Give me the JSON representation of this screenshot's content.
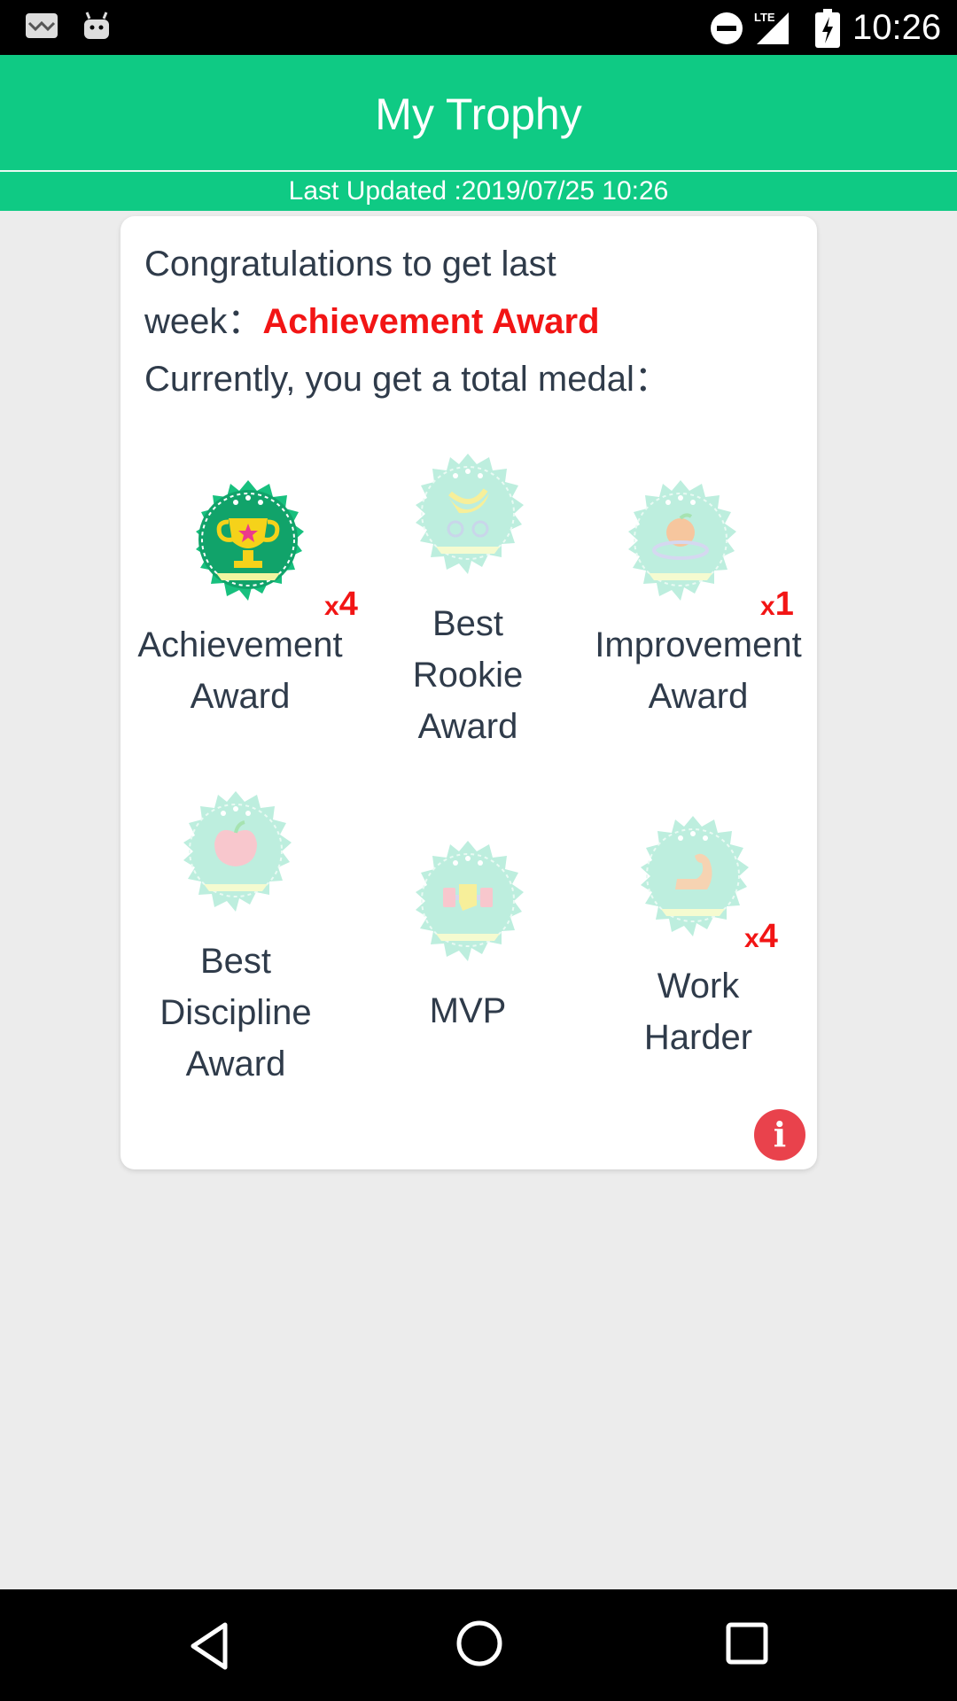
{
  "status_bar": {
    "time": "10:26",
    "network": "LTE",
    "icons": [
      "mail-icon",
      "android-icon",
      "do-not-disturb-icon",
      "lte-signal-icon",
      "battery-charging-icon"
    ]
  },
  "header": {
    "title": "My Trophy",
    "last_updated": "Last Updated :2019/07/25 10:26"
  },
  "card": {
    "congrats_line1": "Congratulations to get last",
    "congrats_line2_prefix": "week：",
    "award_name": "Achievement Award",
    "congrats_line3": "Currently, you get a total medal：",
    "medals": [
      {
        "label_lines": [
          "Achievement",
          "Award"
        ],
        "count_prefix": "x",
        "count": "4",
        "earned": true,
        "icon": "trophy-icon"
      },
      {
        "label_lines": [
          "Best",
          "Rookie",
          "Award"
        ],
        "count_prefix": "",
        "count": "",
        "earned": false,
        "icon": "banana-bike-icon"
      },
      {
        "label_lines": [
          "Improvement",
          "Award"
        ],
        "count_prefix": "x",
        "count": "1",
        "earned": false,
        "icon": "peach-icon"
      },
      {
        "label_lines": [
          "Best",
          "Discipline",
          "Award"
        ],
        "count_prefix": "",
        "count": "",
        "earned": false,
        "icon": "apple-icon"
      },
      {
        "label_lines": [
          "MVP"
        ],
        "count_prefix": "",
        "count": "",
        "earned": false,
        "icon": "fist-dumbbell-icon"
      },
      {
        "label_lines": [
          "Work",
          "Harder"
        ],
        "count_prefix": "x",
        "count": "4",
        "earned": false,
        "icon": "muscle-arm-icon"
      }
    ],
    "info_symbol": "i"
  },
  "colors": {
    "brand_green": "#0fca84",
    "earned_badge": "#17c07e",
    "unearned_badge": "#bdeede",
    "accent_red": "#f21515",
    "info_red": "#e9424c"
  }
}
